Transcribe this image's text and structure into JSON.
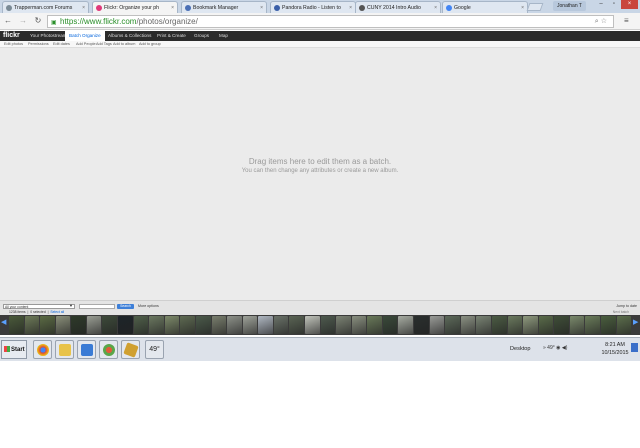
{
  "browser": {
    "tabs": [
      {
        "label": "Trapperman.com Forums",
        "favicon_color": "#7a8a96",
        "active": false
      },
      {
        "label": "Flickr: Organize your ph",
        "favicon_color": "#e0387a",
        "active": true
      },
      {
        "label": "Bookmark Manager",
        "favicon_color": "#4a6fb5",
        "active": false
      },
      {
        "label": "Pandora Radio - Listen to",
        "favicon_color": "#3a5fa8",
        "active": false
      },
      {
        "label": "CUNY 2014 Intro Audio",
        "favicon_color": "#555555",
        "active": false
      },
      {
        "label": "Google",
        "favicon_color": "#4285f4",
        "active": false
      }
    ],
    "user_name": "Jonathan T",
    "url_main": "https://www.flickr.com",
    "url_rest": "/photos/organize/"
  },
  "flickr": {
    "logo": "flickr",
    "nav": [
      {
        "label": "Your Photostream",
        "active": false
      },
      {
        "label": "Batch Organize",
        "active": true
      },
      {
        "label": "Albums & Collections",
        "active": false
      },
      {
        "label": "Print & Create",
        "active": false
      },
      {
        "label": "Groups",
        "active": false
      },
      {
        "label": "Map",
        "active": false
      }
    ],
    "subnav": [
      "Edit photos",
      "Permissions",
      "Edit dates",
      "Add People",
      "Add Tags",
      "Add to album",
      "Add to group"
    ]
  },
  "main": {
    "empty_title": "Drag items here to edit them as a batch.",
    "empty_subtitle": "You can then change any attributes or create a new album."
  },
  "photostream": {
    "filter_value": "All your content",
    "search_button": "Search",
    "more_options": "More options",
    "jump_to": "Jump to date",
    "count_text": "1238 items",
    "selected_text": "0 selected",
    "select_all": "Select all",
    "next_text": "Next batch",
    "thumb_colors": [
      "#4a5a3a",
      "#6d7a58",
      "#5b6b44",
      "#8a8f7a",
      "#2e3a2a",
      "#9a9e94",
      "#3d4a3a",
      "#1d2429",
      "#50604a",
      "#6b7860",
      "#7d8a6a",
      "#5e6a52",
      "#4b5a4a",
      "#7a7f6e",
      "#8e928a",
      "#9fa39a",
      "#b0b8c2",
      "#6a7268",
      "#5a6454",
      "#c0c3ba",
      "#4e5a4e",
      "#7c8374",
      "#8a9080",
      "#6a7a5a",
      "#3a4a3a",
      "#a7aca2",
      "#2a2f2e",
      "#9a9c98",
      "#5d6a5a",
      "#8c9284",
      "#7a8474",
      "#4c5c44",
      "#6b7a5e",
      "#8f9a7e",
      "#5a6c4a",
      "#3f4e38",
      "#7b8a6c",
      "#6a7c5a",
      "#4a5e3e",
      "#5c6e4c"
    ]
  },
  "taskbar": {
    "start_label": "Start",
    "temperature": "49°",
    "desktop_label": "Desktop",
    "tray_text": "49°",
    "time": "8:21 AM",
    "date": "10/15/2015",
    "colors": {
      "chrome": "#db4437",
      "folder": "#e8c34a",
      "app": "#3a7bd5",
      "media": "#5aa64a",
      "other": "#d0a030"
    }
  }
}
